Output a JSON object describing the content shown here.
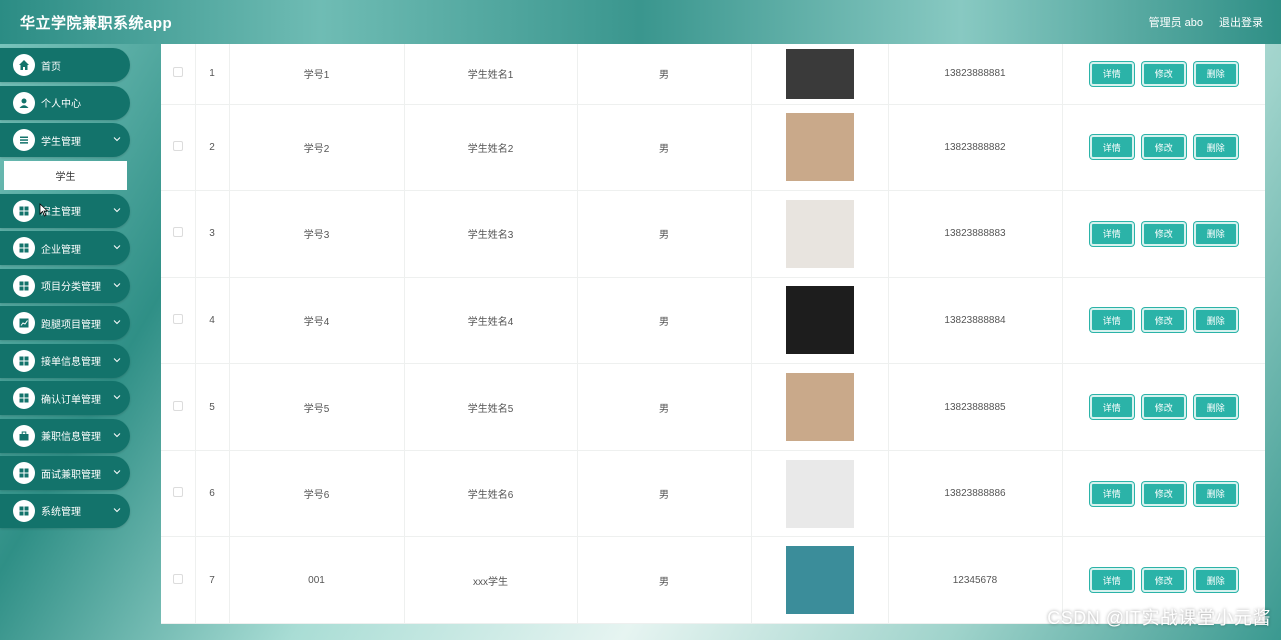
{
  "header": {
    "app_title": "华立学院兼职系统app",
    "user_label": "管理员 abo",
    "logout_label": "退出登录"
  },
  "sidebar": {
    "items": [
      {
        "label": "首页",
        "icon": "home-icon"
      },
      {
        "label": "个人中心",
        "icon": "user-icon"
      },
      {
        "label": "学生管理",
        "icon": "list-icon"
      },
      {
        "label": "雇主管理",
        "icon": "grid-icon"
      },
      {
        "label": "企业管理",
        "icon": "grid-icon"
      },
      {
        "label": "项目分类管理",
        "icon": "grid-icon"
      },
      {
        "label": "跑腿项目管理",
        "icon": "chart-icon"
      },
      {
        "label": "接单信息管理",
        "icon": "grid-icon"
      },
      {
        "label": "确认订单管理",
        "icon": "grid-icon"
      },
      {
        "label": "兼职信息管理",
        "icon": "briefcase-icon"
      },
      {
        "label": "面试兼职管理",
        "icon": "grid-icon"
      },
      {
        "label": "系统管理",
        "icon": "grid-icon"
      }
    ],
    "submenu": {
      "label": "学生"
    }
  },
  "table": {
    "rows": [
      {
        "index": "1",
        "student_id": "学号1",
        "name": "学生姓名1",
        "gender": "男",
        "phone": "13823888881"
      },
      {
        "index": "2",
        "student_id": "学号2",
        "name": "学生姓名2",
        "gender": "男",
        "phone": "13823888882"
      },
      {
        "index": "3",
        "student_id": "学号3",
        "name": "学生姓名3",
        "gender": "男",
        "phone": "13823888883"
      },
      {
        "index": "4",
        "student_id": "学号4",
        "name": "学生姓名4",
        "gender": "男",
        "phone": "13823888884"
      },
      {
        "index": "5",
        "student_id": "学号5",
        "name": "学生姓名5",
        "gender": "男",
        "phone": "13823888885"
      },
      {
        "index": "6",
        "student_id": "学号6",
        "name": "学生姓名6",
        "gender": "男",
        "phone": "13823888886"
      },
      {
        "index": "7",
        "student_id": "001",
        "name": "xxx学生",
        "gender": "男",
        "phone": "12345678"
      }
    ],
    "actions": {
      "detail": "详情",
      "edit": "修改",
      "delete": "删除"
    }
  },
  "watermark": "CSDN @IT实战课堂小元酱",
  "colors": {
    "accent": "#13736b",
    "button": "#2bb3a8"
  }
}
